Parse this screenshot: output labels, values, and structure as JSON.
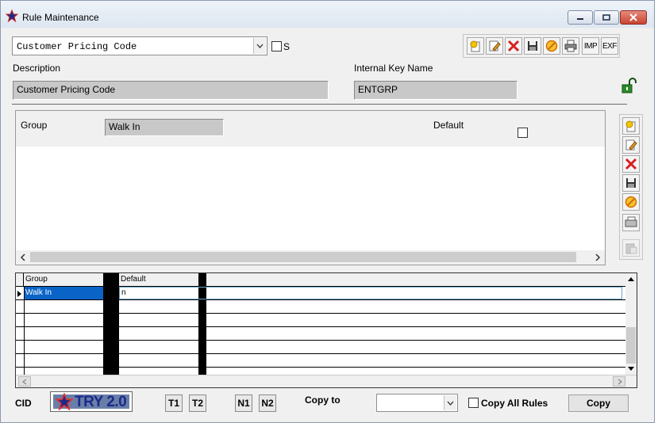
{
  "window": {
    "title": "Rule Maintenance"
  },
  "top": {
    "rule_select_value": "Customer Pricing Code",
    "s_checkbox_label": "S",
    "toolbar": {
      "imp_label": "IMP",
      "exp_label": "EXF"
    }
  },
  "fields": {
    "description_label": "Description",
    "description_value": "Customer Pricing Code",
    "internal_key_label": "Internal Key Name",
    "internal_key_value": "ENTGRP"
  },
  "detail": {
    "group_label": "Group",
    "group_value": "Walk In",
    "default_label": "Default"
  },
  "grid": {
    "columns": [
      "Group",
      "Default"
    ],
    "rows": [
      {
        "group": "Walk In",
        "default": "n"
      }
    ]
  },
  "footer": {
    "cid_label": "CID",
    "logo_text": "TRY 2.0",
    "t1": "T1",
    "t2": "T2",
    "n1": "N1",
    "n2": "N2",
    "copy_to_label": "Copy to",
    "copy_to_value": "",
    "copy_all_label": "Copy All Rules",
    "copy_button": "Copy"
  },
  "colors": {
    "selection": "#0a64c8",
    "accent_green": "#2a8a2a",
    "delete_red": "#d82020",
    "cancel_orange": "#f0a020"
  }
}
